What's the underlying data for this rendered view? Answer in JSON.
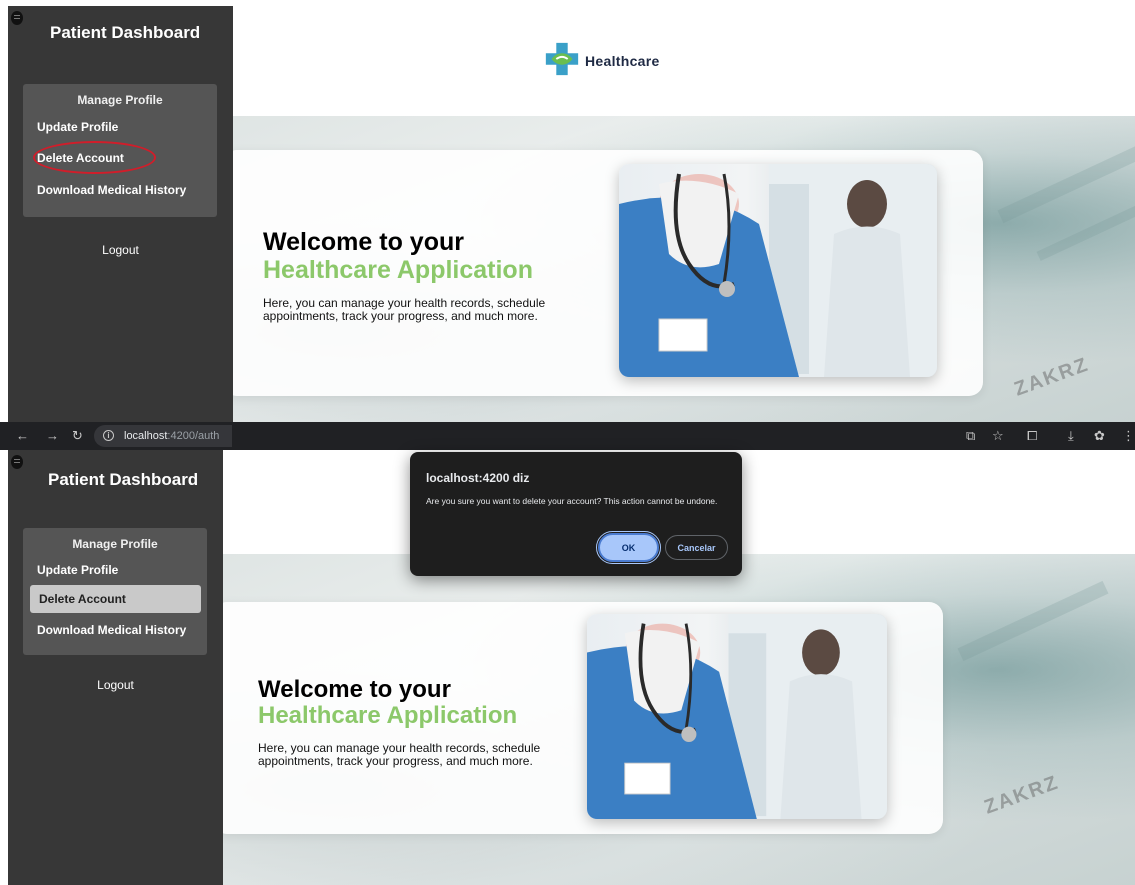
{
  "sidebar": {
    "title": "Patient Dashboard",
    "profile_heading": "Manage Profile",
    "items": [
      {
        "label": "Update Profile"
      },
      {
        "label": "Delete Account"
      },
      {
        "label": "Download Medical History"
      }
    ],
    "logout_label": "Logout"
  },
  "header": {
    "brand_name": "Healthcare",
    "logo_icon": "medical-cross-icon"
  },
  "hero": {
    "welcome_line1": "Welcome to your",
    "welcome_line2": "Healthcare Application",
    "description": "Here, you can manage your health records, schedule appointments, track your progress, and much more.",
    "image_icon": "doctor-photo"
  },
  "browser": {
    "url_host": "localhost",
    "url_rest": ":4200/auth"
  },
  "dialog": {
    "title": "localhost:4200 diz",
    "message": "Are you sure you want to delete your account? This action cannot be undone.",
    "ok_label": "OK",
    "cancel_label": "Cancelar"
  },
  "colors": {
    "sidebar_bg": "#373737",
    "profile_box_bg": "#555555",
    "accent_green": "#8cc86a",
    "highlight_red": "#d11d2a",
    "dialog_bg": "#1e1e1e",
    "ok_button_bg": "#a8c7fa"
  }
}
